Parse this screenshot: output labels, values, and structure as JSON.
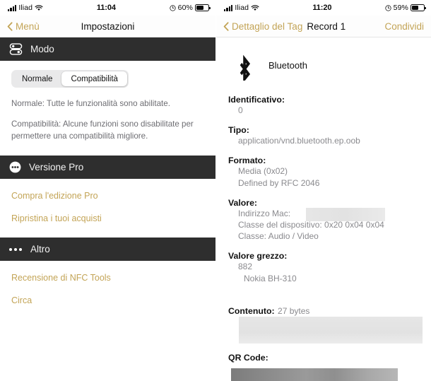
{
  "left": {
    "statusbar": {
      "carrier": "Iliad",
      "time": "11:04",
      "battery_pct": "60%",
      "signal_icon": "cellular-signal-icon",
      "wifi_icon": "wifi-icon",
      "location_icon": "location-services-icon",
      "battery_icon": "battery-icon"
    },
    "navbar": {
      "back_label": "Menù",
      "title": "Impostazioni",
      "back_icon": "chevron-left-icon"
    },
    "sections": [
      {
        "title": "Modo",
        "icon": "switches-icon"
      },
      {
        "title": "Versione Pro",
        "icon": "dots-circle-icon"
      },
      {
        "title": "Altro",
        "icon": "dots-icon"
      }
    ],
    "mode": {
      "segments": [
        {
          "label": "Normale",
          "selected": false
        },
        {
          "label": "Compatibilità",
          "selected": true
        }
      ],
      "help_normale": "Normale: Tutte le funzionalità sono abilitate.",
      "help_compatibilita": "Compatibilità: Alcune funzioni sono disabilitate per permettere una compatibilità migliore."
    },
    "pro_links": [
      {
        "label": "Compra l'edizione Pro"
      },
      {
        "label": "Ripristina i tuoi acquisti"
      }
    ],
    "other_links": [
      {
        "label": "Recensione di NFC Tools"
      },
      {
        "label": "Circa"
      }
    ]
  },
  "right": {
    "statusbar": {
      "carrier": "Iliad",
      "time": "11:20",
      "battery_pct": "59%",
      "signal_icon": "cellular-signal-icon",
      "wifi_icon": "wifi-icon",
      "location_icon": "location-services-icon",
      "battery_icon": "battery-icon"
    },
    "navbar": {
      "back_label": "Dettaglio del Tag",
      "title": "Record 1",
      "action_label": "Condividi",
      "back_icon": "chevron-left-icon"
    },
    "record": {
      "type_icon": "bluetooth-icon",
      "type_title": "Bluetooth",
      "identificativo_label": "Identificativo:",
      "identificativo_value": "0",
      "tipo_label": "Tipo:",
      "tipo_value": "application/vnd.bluetooth.ep.oob",
      "formato_label": "Formato:",
      "formato_value_1": "Media (0x02)",
      "formato_value_2": "Defined by RFC 2046",
      "valore_label": "Valore:",
      "valore_mac_label": "Indirizzo Mac:",
      "valore_mac_redacted": true,
      "valore_classe_dispositivo": "Classe del dispositivo: 0x20 0x04 0x04",
      "valore_classe": "Classe: Audio / Video",
      "valore_grezzo_label": "Valore grezzo:",
      "valore_grezzo_value_1": "882",
      "valore_grezzo_value_2": "Nokia BH-310",
      "contenuto_label": "Contenuto:",
      "contenuto_value": "27 bytes",
      "contenuto_redacted": true,
      "qr_label": "QR Code:",
      "qr_redacted": true
    }
  },
  "colors": {
    "accent_gold": "#c3a456",
    "section_header_bg": "#2e2e2e",
    "value_gray": "#8a8a8e",
    "help_gray": "#6d6d72"
  }
}
